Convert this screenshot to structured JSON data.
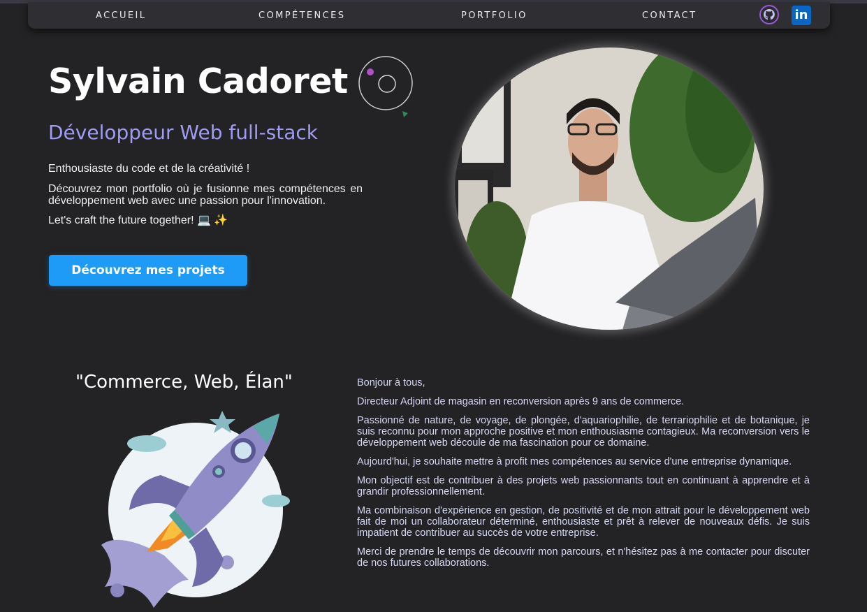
{
  "nav": {
    "items": [
      {
        "label": "ACCUEIL"
      },
      {
        "label": "COMPÉTENCES"
      },
      {
        "label": "PORTFOLIO"
      },
      {
        "label": "CONTACT"
      }
    ],
    "github_icon": "github-icon",
    "linkedin_icon": "linkedin-icon",
    "linkedin_label": "in"
  },
  "hero": {
    "name": "Sylvain Cadoret",
    "role": "Développeur Web full-stack",
    "line1": "Enthousiaste du code et de la créativité !",
    "line2": "Découvrez mon portfolio où je fusionne mes compétences en développement web avec une passion pour l'innovation.",
    "line3": "Let's craft the future together! 💻 ✨",
    "cta": "Découvrez mes projets"
  },
  "about": {
    "motto": "\"Commerce, Web, Élan\"",
    "paragraphs": [
      "Bonjour à tous,",
      "Directeur Adjoint de magasin en reconversion après 9 ans de commerce.",
      "Passionné de nature, de voyage, de plongée, d'aquariophilie, de terrariophilie et de botanique, je suis reconnu pour mon approche positive et mon enthousiasme contagieux. Ma reconversion vers le développement web découle de ma fascination pour ce domaine.",
      "Aujourd'hui, je souhaite mettre à profit mes compétences au service d'une entreprise dynamique.",
      "Mon objectif est de contribuer à des projets web passionnants tout en continuant à apprendre et à grandir professionnellement.",
      "Ma combinaison d'expérience en gestion, de positivité et de mon attrait pour le développement web fait de moi un collaborateur déterminé, enthousiaste et prêt à relever de nouveaux défis. Je suis impatient de contribuer au succès de votre entreprise.",
      "Merci de prendre le temps de découvrir mon parcours, et n'hésitez pas à me contacter pour discuter de nos futures collaborations."
    ]
  },
  "colors": {
    "background": "#232224",
    "accent_purple": "#9f9cf2",
    "cta_blue": "#1e9bf7",
    "about_text": "#d6d8f6"
  }
}
